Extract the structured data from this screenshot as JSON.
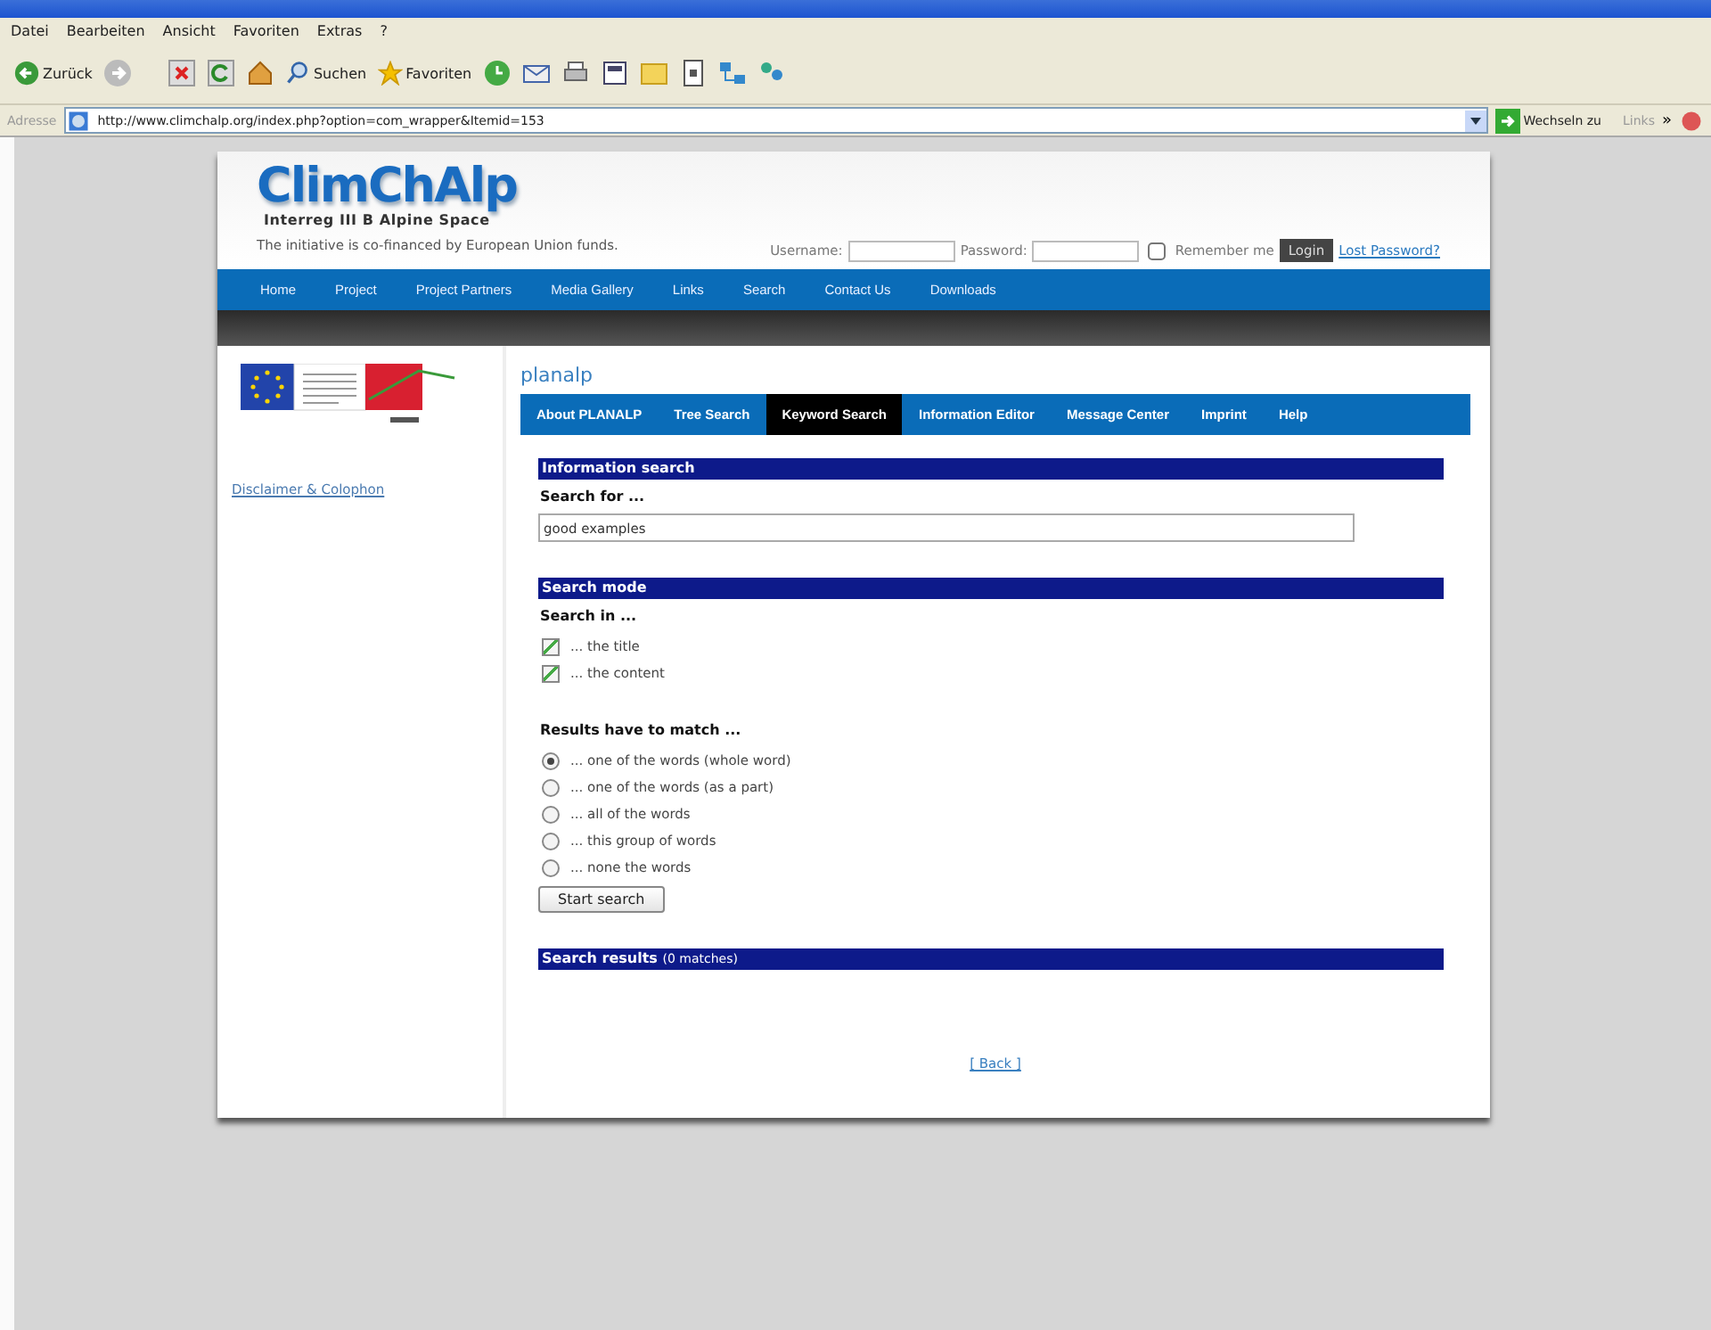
{
  "browser": {
    "menu": [
      "Datei",
      "Bearbeiten",
      "Ansicht",
      "Favoriten",
      "Extras",
      "?"
    ],
    "toolbar": {
      "back_label": "Zurück",
      "search_label": "Suchen",
      "favorites_label": "Favoriten"
    },
    "address": {
      "label": "Adresse",
      "url": "http://www.climchalp.org/index.php?option=com_wrapper&Itemid=153",
      "go_label": "Wechseln zu",
      "links_label": "Links",
      "more": "»"
    }
  },
  "site": {
    "logo": "ClimChAlp",
    "subtitle": "Interreg III B Alpine Space",
    "tagline": "The initiative is co-financed by European Union funds.",
    "login": {
      "username_label": "Username:",
      "password_label": "Password:",
      "remember_label": "Remember me",
      "remember_checked": false,
      "button": "Login",
      "lost_password": "Lost Password?"
    },
    "nav": [
      "Home",
      "Project",
      "Project Partners",
      "Media Gallery",
      "Links",
      "Search",
      "Contact Us",
      "Downloads"
    ],
    "sidebar_link": "Disclaimer & Colophon"
  },
  "app": {
    "title": "planalp",
    "tabs": [
      {
        "label": "About PLANALP",
        "selected": false
      },
      {
        "label": "Tree Search",
        "selected": false
      },
      {
        "label": "Keyword Search",
        "selected": true
      },
      {
        "label": "Information Editor",
        "selected": false
      },
      {
        "label": "Message Center",
        "selected": false
      },
      {
        "label": "Imprint",
        "selected": false
      },
      {
        "label": "Help",
        "selected": false
      }
    ],
    "info_heading": "Information search",
    "search_for_label": "Search for ...",
    "search_value": "good examples",
    "mode_heading": "Search mode",
    "search_in_label": "Search in ...",
    "search_in": [
      {
        "label": "... the title",
        "checked": true
      },
      {
        "label": "... the content",
        "checked": true
      }
    ],
    "match_label": "Results have to match ...",
    "match_options": [
      {
        "label": "... one of the words (whole word)",
        "selected": true
      },
      {
        "label": "... one of the words (as a part)",
        "selected": false
      },
      {
        "label": "... all of the words",
        "selected": false
      },
      {
        "label": "... this group of words",
        "selected": false
      },
      {
        "label": "... none the words",
        "selected": false
      }
    ],
    "start_button": "Start search",
    "results_heading": "Search results",
    "results_count": "(0 matches)",
    "back_link": "[ Back ]"
  }
}
